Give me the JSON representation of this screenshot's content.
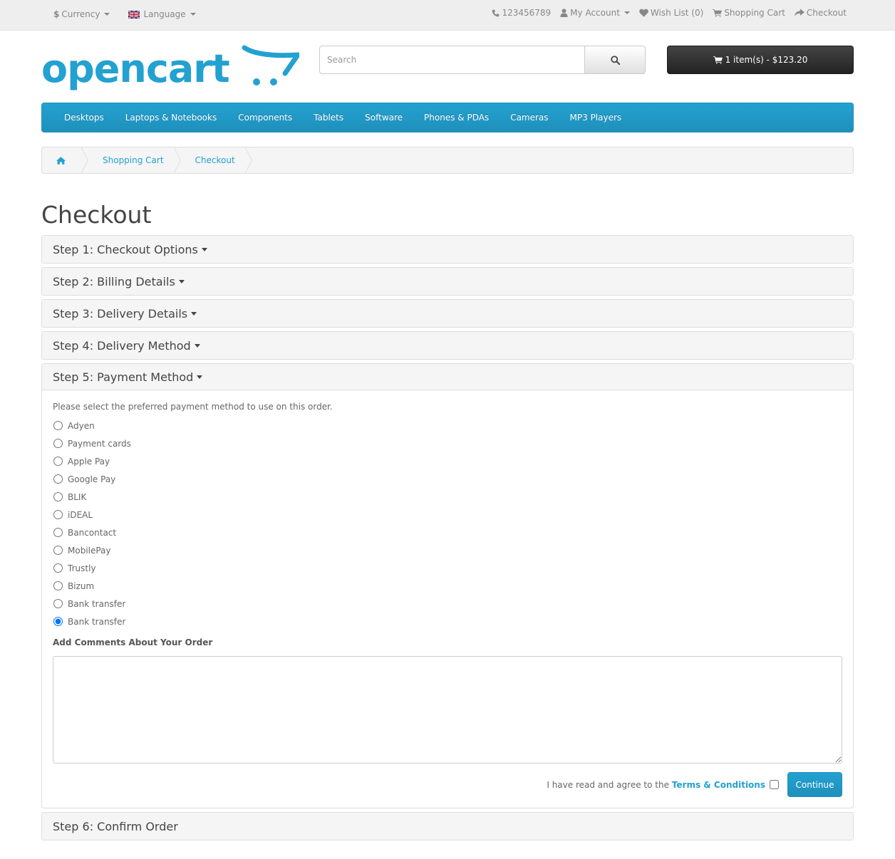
{
  "topbar": {
    "currency_label": "Currency",
    "currency_symbol": "$",
    "language_label": "Language",
    "phone": "123456789",
    "my_account": "My Account",
    "wish_list": "Wish List (0)",
    "shopping_cart": "Shopping Cart",
    "checkout": "Checkout"
  },
  "brand": {
    "logo_text": "opencart",
    "accent_color": "#23a1d1"
  },
  "search": {
    "placeholder": "Search"
  },
  "cart": {
    "summary": "1 item(s) - $123.20"
  },
  "menu": [
    "Desktops",
    "Laptops & Notebooks",
    "Components",
    "Tablets",
    "Software",
    "Phones & PDAs",
    "Cameras",
    "MP3 Players"
  ],
  "breadcrumb": {
    "home_icon": "home-icon",
    "items": [
      "Shopping Cart",
      "Checkout"
    ]
  },
  "page": {
    "title": "Checkout"
  },
  "steps": [
    "Step 1: Checkout Options",
    "Step 2: Billing Details",
    "Step 3: Delivery Details",
    "Step 4: Delivery Method",
    "Step 5: Payment Method",
    "Step 6: Confirm Order"
  ],
  "payment": {
    "intro": "Please select the preferred payment method to use on this order.",
    "methods": [
      "Adyen",
      "Payment cards",
      "Apple Pay",
      "Google Pay",
      "BLIK",
      "iDEAL",
      "Bancontact",
      "MobilePay",
      "Trustly",
      "Bizum",
      "Bank transfer",
      "Bank transfer"
    ],
    "selected_index": 11,
    "comments_label": "Add Comments About Your Order",
    "comments_value": "",
    "agree_prefix": "I have read and agree to the",
    "terms_link": "Terms & Conditions",
    "agree_checked": false,
    "continue_label": "Continue"
  }
}
